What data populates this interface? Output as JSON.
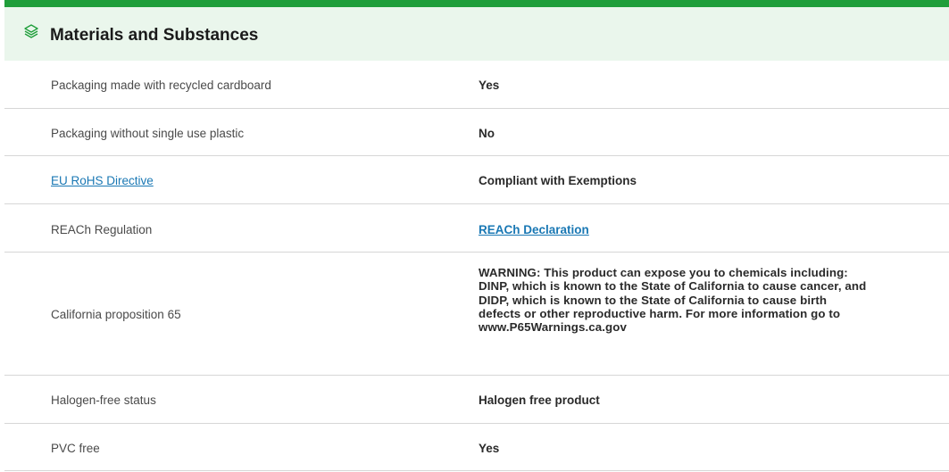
{
  "section": {
    "title": "Materials and Substances",
    "icon": "layers-icon",
    "accent_color": "#1f9e3a",
    "header_bg": "#eaf6ec"
  },
  "rows": [
    {
      "label": "Packaging made with recycled cardboard",
      "value": "Yes"
    },
    {
      "label": "Packaging without single use plastic",
      "value": "No"
    },
    {
      "label": "EU RoHS Directive",
      "value": "Compliant with Exemptions"
    },
    {
      "label": "REACh Regulation",
      "value": "REACh Declaration"
    },
    {
      "label": "California proposition 65",
      "value": "WARNING: This product can expose you to chemicals including: DINP, which is known to the State of California to cause cancer, and DIDP, which is known to the State of California to cause birth defects or other reproductive harm. For more information go to www.P65Warnings.ca.gov"
    },
    {
      "label": "Halogen-free status",
      "value": "Halogen free product"
    },
    {
      "label": "PVC free",
      "value": "Yes"
    }
  ],
  "link_color": "#1a78b4"
}
